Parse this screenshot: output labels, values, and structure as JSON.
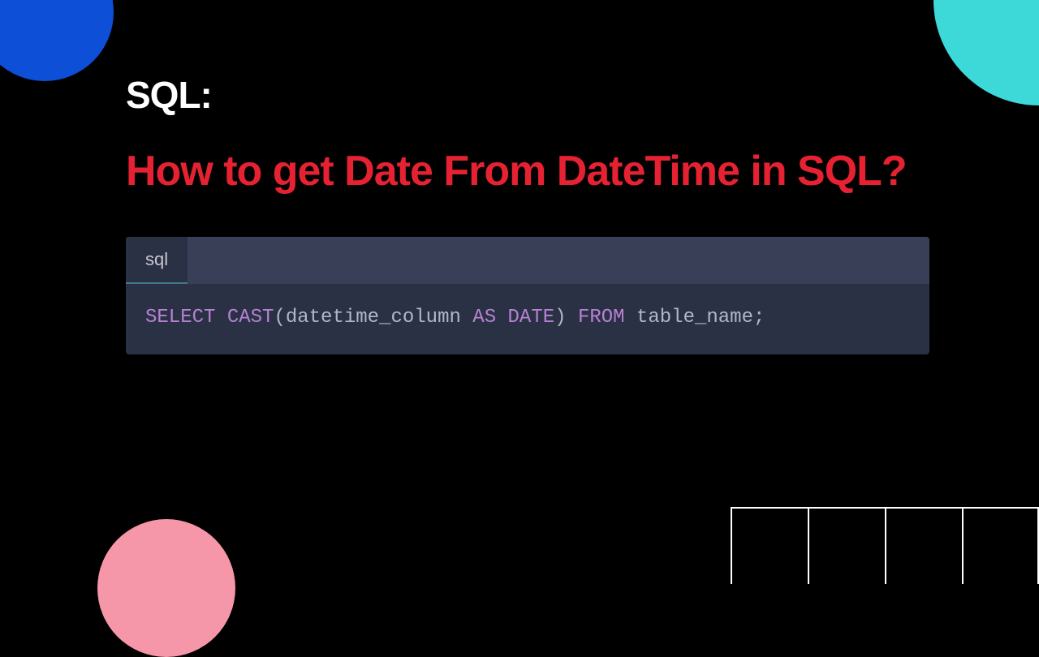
{
  "title": {
    "prefix": "SQL:",
    "main": "How to get Date From DateTime in SQL?"
  },
  "code": {
    "tab_label": "sql",
    "tokens": {
      "select": "SELECT",
      "cast": "CAST",
      "open_paren": "(",
      "col": "datetime_column",
      "as": "AS",
      "date": "DATE",
      "close_paren": ")",
      "from": "FROM",
      "table": "table_name",
      "semi": ";"
    }
  },
  "decorations": {
    "blue_circle": "blue-circle",
    "cyan_quarter": "cyan-quarter",
    "pink_circle": "pink-circle",
    "grid_cells": 4
  }
}
